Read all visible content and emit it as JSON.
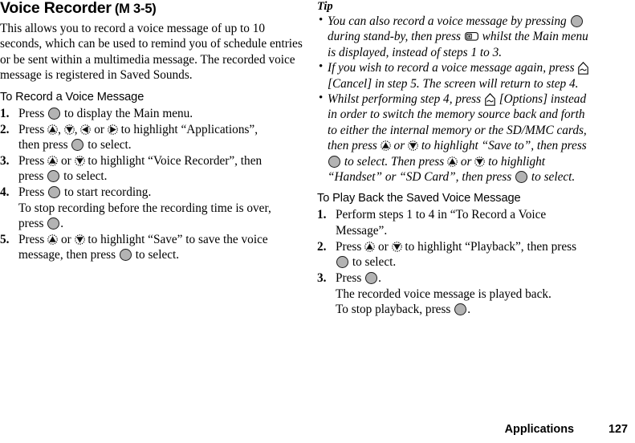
{
  "document": {
    "title": "Voice Recorder",
    "title_suffix": "(M 3-5)",
    "intro": "This allows you to record a voice message of up to 10 seconds, which can be used to remind you of schedule entries or be sent within a multimedia message. The recorded voice message is registered in Saved Sounds."
  },
  "icons": {
    "center_key": "center-select-key-icon",
    "up_key": "navigation-up-key-icon",
    "down_key": "navigation-down-key-icon",
    "left_key": "navigation-left-key-icon",
    "right_key": "navigation-right-key-icon",
    "camera_key": "camera-key-icon",
    "soft_key": "left-soft-key-icon"
  },
  "colors": {
    "key_fill": "#b3b3b3",
    "key_outline": "#1a1a1a",
    "text": "#000000",
    "background": "#ffffff"
  },
  "record_section": {
    "heading": "To Record a Voice Message",
    "steps": [
      {
        "number": "1.",
        "part_a": "Press",
        "part_b": "to display the Main menu."
      },
      {
        "number": "2.",
        "part_a": "Press",
        "comma1": ",",
        "comma2": ",",
        "or_text": "or",
        "part_b": "to highlight “Applications”,",
        "part_c": "then press",
        "part_d": "to select."
      },
      {
        "number": "3.",
        "part_a": "Press",
        "or_text": "or",
        "part_b": "to highlight “Voice Recorder”, then",
        "part_c": "press",
        "part_d": "to select."
      },
      {
        "number": "4.",
        "part_a": "Press",
        "part_b": "to start recording.",
        "part_c": "To stop recording before the recording time is over,",
        "part_d": "press",
        "part_e": "."
      },
      {
        "number": "5.",
        "part_a": "Press",
        "or_text": "or",
        "part_b": "to highlight “Save” to save the voice",
        "part_c": "message, then press",
        "part_d": "to select."
      }
    ]
  },
  "tip_section": {
    "heading": "Tip",
    "bullet_char": "•",
    "tips": [
      {
        "part_a": "You can also record a voice message by pressing",
        "part_b": "during stand-by, then press",
        "part_c": "whilst the Main menu",
        "part_d": "is displayed, instead of steps 1 to 3."
      },
      {
        "part_a": "If you wish to record a voice message again, press",
        "part_b": "[Cancel] in step 5. The screen will return to step 4."
      },
      {
        "part_a": "Whilst performing step 4, press",
        "part_b": "[Options] instead",
        "part_c": "in order to switch the memory source back and forth",
        "part_d": "to either the internal memory or the SD/MMC cards,",
        "part_e": "then press",
        "or_text_1": "or",
        "part_f": "to highlight “Save to”, then press",
        "part_g": "to select. Then press",
        "or_text_2": "or",
        "part_h": "to highlight",
        "part_i": "“Handset” or “SD Card”, then press",
        "part_j": "to select."
      }
    ]
  },
  "playback_section": {
    "heading": "To Play Back the Saved Voice Message",
    "steps": [
      {
        "number": "1.",
        "part_a": "Perform steps 1 to 4 in “To Record a Voice",
        "part_b": "Message”."
      },
      {
        "number": "2.",
        "part_a": "Press",
        "or_text": "or",
        "part_b": "to highlight “Playback”, then press",
        "part_c": "to select."
      },
      {
        "number": "3.",
        "part_a": "Press",
        "part_b": ".",
        "part_c": "The recorded voice message is played back.",
        "part_d": "To stop playback, press",
        "part_e": "."
      }
    ]
  },
  "footer": {
    "chapter": "Applications",
    "page_number": "127"
  }
}
